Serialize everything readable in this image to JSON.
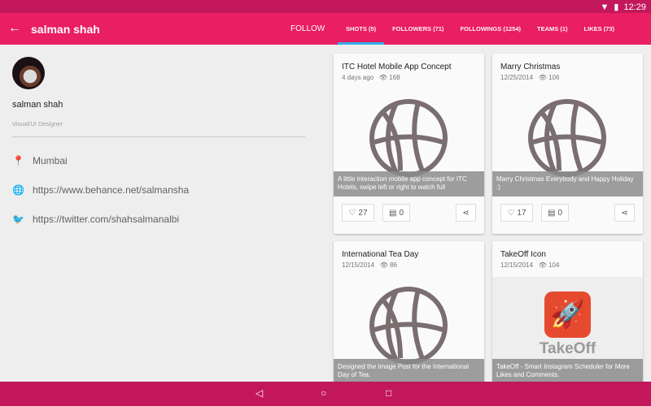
{
  "status": {
    "time": "12:29"
  },
  "toolbar": {
    "title": "salman shah",
    "follow": "FOLLOW"
  },
  "tabs": [
    {
      "label": "SHOTS (5)",
      "active": true
    },
    {
      "label": "FOLLOWERS (71)"
    },
    {
      "label": "FOLLOWINGS (1254)"
    },
    {
      "label": "TEAMS (1)"
    },
    {
      "label": "LIKES (73)"
    }
  ],
  "profile": {
    "name": "salman shah",
    "role": "Visual/UI Designer",
    "location": "Mumbai",
    "website": "https://www.behance.net/salmansha",
    "twitter": "https://twitter.com/shahsalmanalbi"
  },
  "shots": [
    {
      "title": "ITC Hotel Mobile App Concept",
      "date": "4 days ago",
      "views": "168",
      "caption": "A little interaction mobile app concept for ITC Hotels, swipe left or right to watch full",
      "likes": "27",
      "comments": "0"
    },
    {
      "title": "Marry Christmas",
      "date": "12/25/2014",
      "views": "106",
      "caption": "Marry Christmas Everybody and Happy Holiday :)",
      "likes": "17",
      "comments": "0"
    },
    {
      "title": "International Tea Day",
      "date": "12/15/2014",
      "views": "86",
      "caption": "Designed the Image Post for the International Day of Tea."
    },
    {
      "title": "TakeOff Icon",
      "date": "12/15/2014",
      "views": "104",
      "caption": "TakeOff - Smart Instagram Scheduler for More Likes and Comments.",
      "image_text": "TakeOff"
    }
  ],
  "colors": {
    "primary": "#e91e63",
    "primary_dark": "#c2185b",
    "accent": "#29b6f6"
  }
}
